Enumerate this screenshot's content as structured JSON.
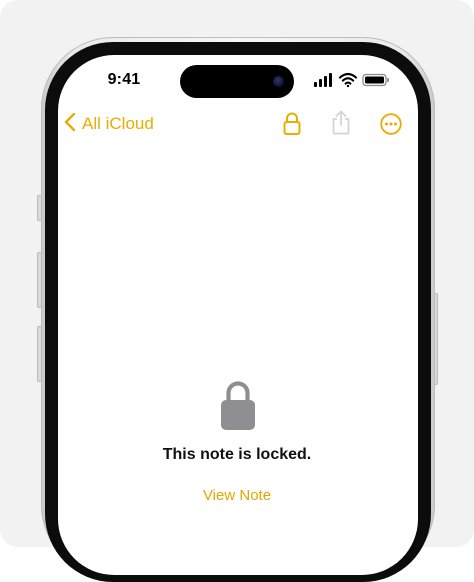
{
  "status_bar": {
    "time": "9:41",
    "icons": [
      "cellular-signal-icon",
      "wifi-icon",
      "battery-icon"
    ]
  },
  "nav": {
    "back_label": "All iCloud",
    "back_icon": "chevron-left-icon",
    "actions": [
      "lock-icon",
      "share-icon",
      "more-icon"
    ],
    "accent_color": "#F2B600"
  },
  "locked_view": {
    "icon": "lock-icon",
    "message": "This note is locked.",
    "view_note_label": "View Note"
  }
}
